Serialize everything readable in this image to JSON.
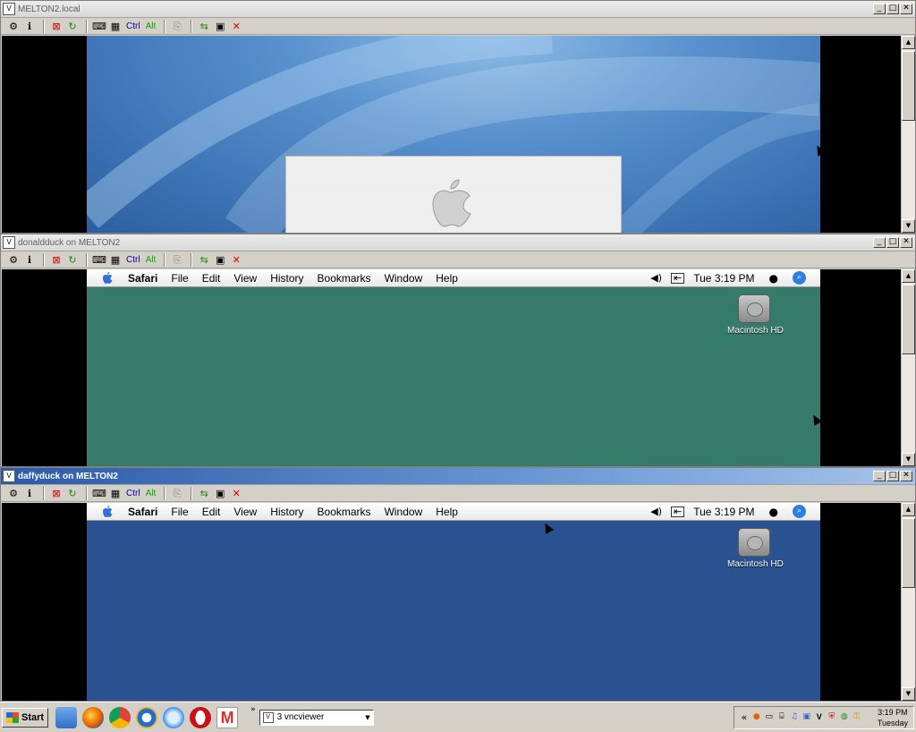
{
  "windows": [
    {
      "title": "MELTON2.local",
      "active": false,
      "screen": "login"
    },
    {
      "title": "donaldduck on MELTON2",
      "active": false,
      "screen": "desktop",
      "bg": "#367a6a",
      "menubar": {
        "app": "Safari",
        "items": [
          "File",
          "Edit",
          "View",
          "History",
          "Bookmarks",
          "Window",
          "Help"
        ],
        "clock": "Tue 3:19 PM"
      },
      "desktop_icon": "Macintosh HD"
    },
    {
      "title": "daffyduck on MELTON2",
      "active": true,
      "screen": "desktop",
      "bg": "#2a5190",
      "menubar": {
        "app": "Safari",
        "items": [
          "File",
          "Edit",
          "View",
          "History",
          "Bookmarks",
          "Window",
          "Help"
        ],
        "clock": "Tue 3:19 PM"
      },
      "desktop_icon": "Macintosh HD"
    }
  ],
  "toolbar": {
    "ctrl": "Ctrl",
    "alt": "Alt"
  },
  "window_buttons": {
    "minimize": "_",
    "maximize": "□",
    "close": "✕"
  },
  "taskbar": {
    "start_label": "Start",
    "task_label": "3 vncviewer",
    "tray_chevron": "«",
    "clock_time": "3:19 PM",
    "clock_day": "Tuesday"
  },
  "colors": {
    "login_bg": "#4f86c4",
    "accent_title": "#2b5aa8"
  }
}
